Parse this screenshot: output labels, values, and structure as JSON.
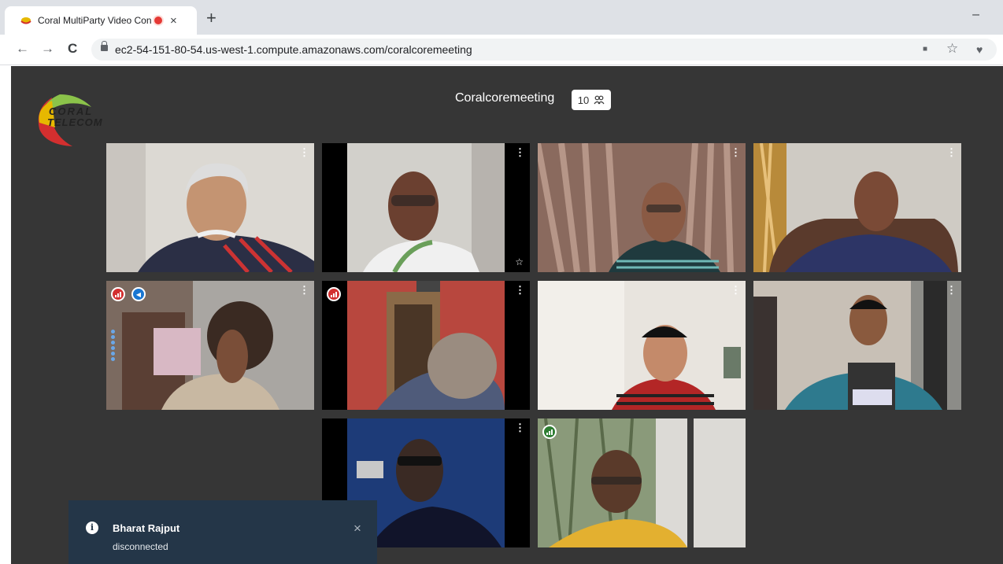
{
  "browser": {
    "tab_title": "Coral MultiParty Video Confe",
    "tab_close": "×",
    "new_tab": "+",
    "minimize": "–",
    "back": "←",
    "forward": "→",
    "reload": "C",
    "url": "ec2-54-151-80-54.us-west-1.compute.amazonaws.com/coralcoremeeting",
    "camera_icon": "■",
    "star_icon": "☆",
    "extension_icon": "♥"
  },
  "app": {
    "logo_line1": "CORAL",
    "logo_line2": "TELECOM",
    "meeting_title": "Coralcoremeeting",
    "participant_count": "10",
    "more_glyph": "⋮",
    "star_glyph": "☆",
    "participants": [
      {
        "id": 1,
        "indicators": []
      },
      {
        "id": 2,
        "indicators": [],
        "starred": true
      },
      {
        "id": 3,
        "indicators": []
      },
      {
        "id": 4,
        "indicators": []
      },
      {
        "id": 5,
        "indicators": [
          "network-poor",
          "dominant-speaker"
        ],
        "active": true
      },
      {
        "id": 6,
        "indicators": [
          "network-poor"
        ]
      },
      {
        "id": 7,
        "indicators": []
      },
      {
        "id": 8,
        "indicators": []
      },
      {
        "id": 9,
        "indicators": []
      },
      {
        "id": 10,
        "indicators": [
          "network-good"
        ]
      }
    ]
  },
  "colors": {
    "app_bg": "#363636",
    "active_border": "#2f6ab4",
    "network_poor": "#d32f2f",
    "network_good": "#2e7d32",
    "speaker": "#1976d2",
    "toast_bg": "#243648"
  },
  "notification": {
    "icon": "i",
    "name": "Bharat Rajput",
    "message": "disconnected",
    "close": "×"
  }
}
